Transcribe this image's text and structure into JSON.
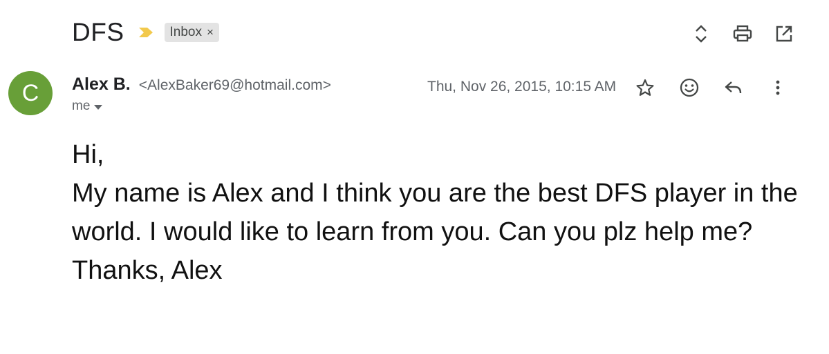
{
  "email": {
    "subject": "DFS",
    "label": "Inbox",
    "label_remove": "×",
    "sender": {
      "initial": "C",
      "name": "Alex B.",
      "email": "<AlexBaker69@hotmail.com>"
    },
    "recipient": "me",
    "date": "Thu, Nov 26, 2015, 10:15 AM",
    "body": "Hi,\nMy name is Alex and I think you are the best DFS player in the world. I would like to learn from you.  Can you plz help me?  Thanks, Alex"
  },
  "colors": {
    "avatar": "#689f38",
    "importance_marker": "#f2c94c",
    "chip_background": "#e3e3e3"
  },
  "icons": {
    "importance": "importance-marker-icon",
    "expand_collapse": "unfold-icon",
    "print": "printer-icon",
    "new_window": "open-in-new-icon",
    "star": "star-outline-icon",
    "emoji": "emoji-icon",
    "reply": "reply-icon",
    "more": "more-vert-icon"
  }
}
